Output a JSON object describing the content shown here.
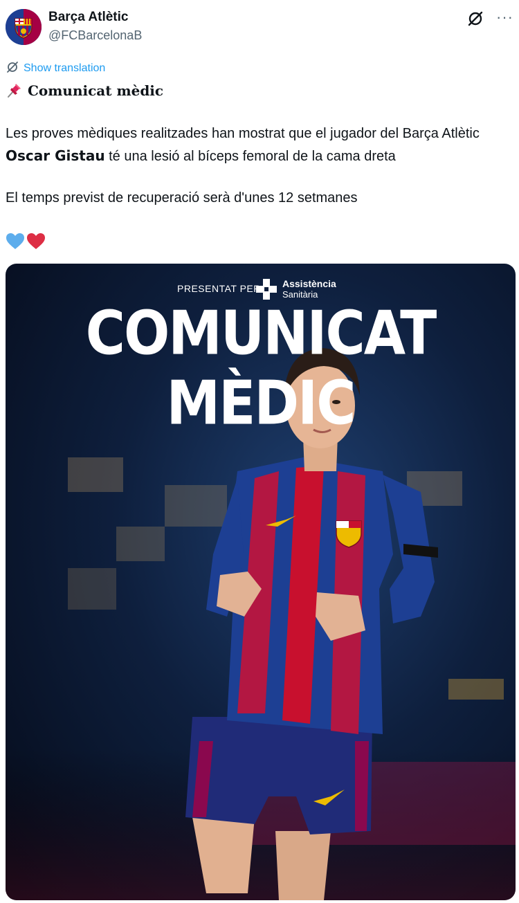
{
  "account": {
    "name": "Barça Atlètic",
    "handle": "@FCBarcelonaB"
  },
  "tweet": {
    "show_translation": "Show translation",
    "title": "Comunicat mèdic",
    "para1_before": "Les proves mèdiques realitzades han mostrat que el jugador del Barça Atlètic ",
    "para1_player": "Oscar Gistau",
    "para1_after": " té una lesió al bíceps femoral de la cama dreta",
    "para2": "El temps previst de recuperació serà d'unes 12 setmanes"
  },
  "media": {
    "presented_by": "PRESENTAT PER",
    "sponsor_name": "Assistència",
    "sponsor_sub": "Sanitària",
    "headline": "COMUNICAT MÈDIC"
  },
  "colors": {
    "link": "#1d9bf0",
    "secondary": "#536471",
    "barca_blue": "#1d3f93",
    "barca_red": "#c8102e"
  },
  "icons": [
    "grok-icon",
    "more-icon",
    "translate-icon",
    "pin-icon",
    "blue-heart-icon",
    "red-heart-icon",
    "sponsor-logo-icon"
  ]
}
